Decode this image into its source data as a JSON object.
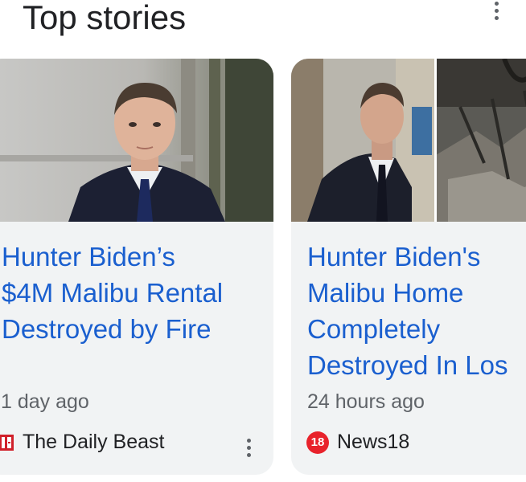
{
  "header": {
    "title": "Top stories"
  },
  "icons": {
    "more": "more-vert-icon",
    "daily_beast_logo": "daily-beast-logo-icon",
    "news18_logo": "news18-logo-icon"
  },
  "colors": {
    "headline": "#1a5fcf",
    "card_bg": "#f1f3f4",
    "news18_red": "#e8222b",
    "beast_red": "#d0202a"
  },
  "stories": [
    {
      "headline_lines": [
        "Hunter Biden’s",
        "$4M Malibu Rental",
        "Destroyed by Fire"
      ],
      "time": "1 day ago",
      "source": "The Daily Beast"
    },
    {
      "headline_lines": [
        "Hunter Biden's",
        "Malibu Home",
        "Completely",
        "Destroyed In Los"
      ],
      "time": "24 hours ago",
      "source": "News18",
      "source_logo_text": "18"
    }
  ]
}
